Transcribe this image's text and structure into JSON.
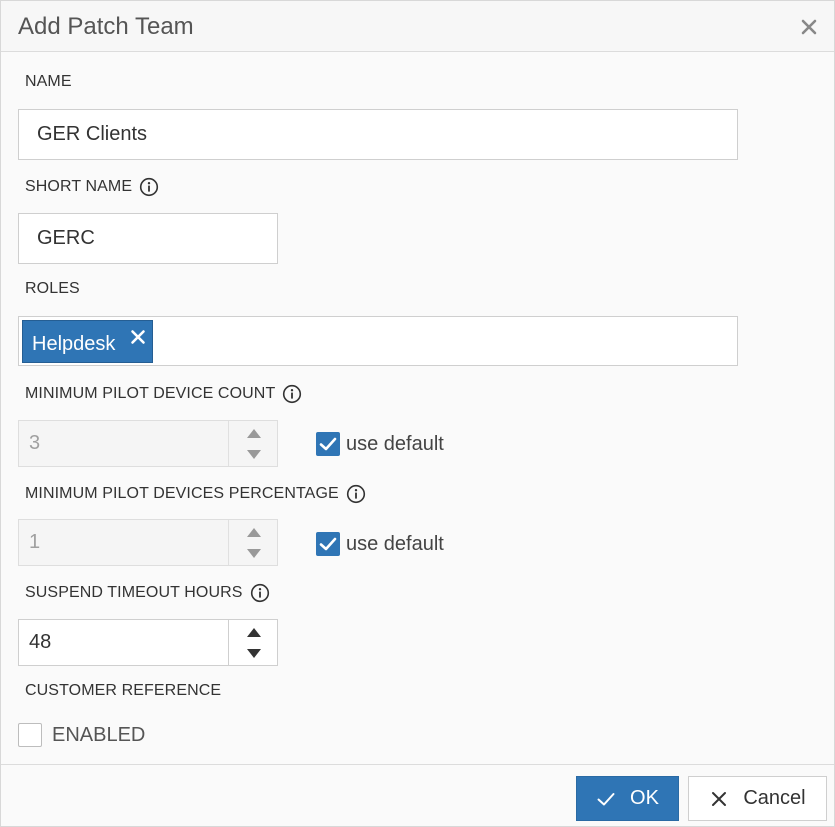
{
  "dialog": {
    "title": "Add Patch Team",
    "close_icon": "close-icon"
  },
  "fields": {
    "name": {
      "label": "NAME",
      "value": "GER Clients"
    },
    "short_name": {
      "label": "SHORT NAME",
      "value": "GERC",
      "info_icon": "info-icon"
    },
    "roles": {
      "label": "ROLES",
      "tags": [
        "Helpdesk"
      ],
      "remove_icon": "close-icon"
    },
    "min_pilot_device_count": {
      "label": "MINIMUM PILOT DEVICE COUNT",
      "value": "3",
      "use_default_label": "use default",
      "use_default_checked": true,
      "disabled": true
    },
    "min_pilot_devices_percentage": {
      "label": "MINIMUM PILOT DEVICES PERCENTAGE",
      "value": "1",
      "use_default_label": "use default",
      "use_default_checked": true,
      "disabled": true
    },
    "suspend_timeout_hours": {
      "label": "SUSPEND TIMEOUT HOURS",
      "value": "48"
    },
    "customer_reference": {
      "label": "CUSTOMER REFERENCE",
      "enabled_label": "ENABLED",
      "enabled_checked": false
    }
  },
  "footer": {
    "ok_label": "OK",
    "cancel_label": "Cancel"
  },
  "colors": {
    "accent": "#2f75b5",
    "border": "#cfcfcf",
    "text": "#333333"
  }
}
